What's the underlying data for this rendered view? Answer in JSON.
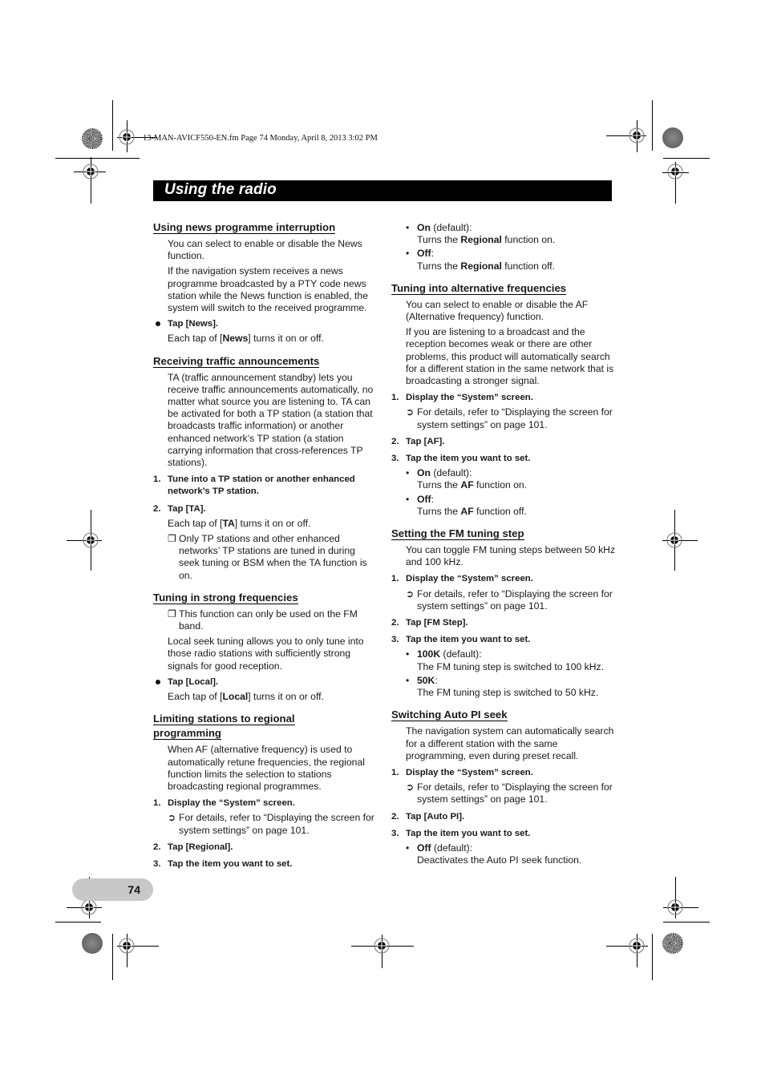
{
  "file_header": "13-MAN-AVICF550-EN.fm  Page 74  Monday, April 8, 2013  3:02 PM",
  "chapter_title": "Using the radio",
  "page_number": "74",
  "left_column": {
    "news": {
      "heading": "Using news programme interruption",
      "p1": "You can select to enable or disable the News function.",
      "p2": "If the navigation system receives a news programme broadcasted by a PTY code news station while the News function is enabled, the system will switch to the received programme.",
      "action": "Tap [News].",
      "result_pre": "Each tap of [",
      "result_bold": "News",
      "result_post": "] turns it on or off."
    },
    "traffic": {
      "heading": "Receiving traffic announcements",
      "p1": "TA (traffic announcement standby) lets you receive traffic announcements automatically, no matter what source you are listening to. TA can be activated for both a TP station (a station that broadcasts traffic information) or another enhanced network’s TP station (a station carrying information that cross-references TP stations).",
      "step1_num": "1.",
      "step1": "Tune into a TP station or another enhanced network’s TP station.",
      "step2_num": "2.",
      "step2": "Tap [TA].",
      "result_pre": "Each tap of [",
      "result_bold": "TA",
      "result_post": "] turns it on or off.",
      "note_symbol": "❐",
      "note": "Only TP stations and other enhanced networks’ TP stations are tuned in during seek tuning or BSM when the TA function is on."
    },
    "strong": {
      "heading": "Tuning in strong frequencies",
      "note_symbol": "❐",
      "note": "This function can only be used on the FM band.",
      "p1": "Local seek tuning allows you to only tune into those radio stations with sufficiently strong signals for good reception.",
      "action": "Tap [Local].",
      "result_pre": "Each tap of [",
      "result_bold": "Local",
      "result_post": "] turns it on or off."
    },
    "regional": {
      "heading_line1": "Limiting stations to regional",
      "heading_line2": "programming",
      "p1": "When AF (alternative frequency) is used to automatically retune frequencies, the regional function limits the selection to stations broadcasting regional programmes.",
      "step1_num": "1.",
      "step1": "Display the “System” screen.",
      "ref_symbol": "➲",
      "ref": "For details, refer to “Displaying the screen for system settings” on page 101.",
      "step2_num": "2.",
      "step2": "Tap [Regional].",
      "step3_num": "3.",
      "step3": "Tap the item you want to set."
    }
  },
  "right_column": {
    "regional_options": [
      {
        "label": "On",
        "suffix": " (default):",
        "desc_pre": "Turns the ",
        "desc_bold": "Regional",
        "desc_post": " function on."
      },
      {
        "label": "Off",
        "suffix": ":",
        "desc_pre": "Turns the ",
        "desc_bold": "Regional",
        "desc_post": " function off."
      }
    ],
    "af": {
      "heading": "Tuning into alternative frequencies",
      "p1": "You can select to enable or disable the AF (Alternative frequency) function.",
      "p2": "If you are listening to a broadcast and the reception becomes weak or there are other problems, this product will automatically search for a different station in the same network that is broadcasting a stronger signal.",
      "step1_num": "1.",
      "step1": "Display the “System” screen.",
      "ref_symbol": "➲",
      "ref": "For details, refer to “Displaying the screen for system settings” on page 101.",
      "step2_num": "2.",
      "step2": "Tap [AF].",
      "step3_num": "3.",
      "step3": "Tap the item you want to set.",
      "options": [
        {
          "label": "On",
          "suffix": " (default):",
          "desc_pre": "Turns the ",
          "desc_bold": "AF",
          "desc_post": " function on."
        },
        {
          "label": "Off",
          "suffix": ":",
          "desc_pre": "Turns the ",
          "desc_bold": "AF",
          "desc_post": " function off."
        }
      ]
    },
    "fmstep": {
      "heading": "Setting the FM tuning step",
      "p1": "You can toggle FM tuning steps between 50 kHz and 100 kHz.",
      "step1_num": "1.",
      "step1": "Display the “System” screen.",
      "ref_symbol": "➲",
      "ref": "For details, refer to “Displaying the screen for system settings” on page 101.",
      "step2_num": "2.",
      "step2": "Tap [FM Step].",
      "step3_num": "3.",
      "step3": "Tap the item you want to set.",
      "options": [
        {
          "label": "100K",
          "suffix": " (default):",
          "desc": "The FM tuning step is switched to 100 kHz."
        },
        {
          "label": "50K",
          "suffix": ":",
          "desc": "The FM tuning step is switched to 50 kHz."
        }
      ]
    },
    "autopi": {
      "heading": "Switching Auto PI seek",
      "p1": "The navigation system can automatically search for a different station with the same programming, even during preset recall.",
      "step1_num": "1.",
      "step1": "Display the “System” screen.",
      "ref_symbol": "➲",
      "ref": "For details, refer to “Displaying the screen for system settings” on page 101.",
      "step2_num": "2.",
      "step2": "Tap [Auto PI].",
      "step3_num": "3.",
      "step3": "Tap the item you want to set.",
      "options": [
        {
          "label": "Off",
          "suffix": " (default):",
          "desc": "Deactivates the Auto PI seek function."
        }
      ]
    }
  }
}
